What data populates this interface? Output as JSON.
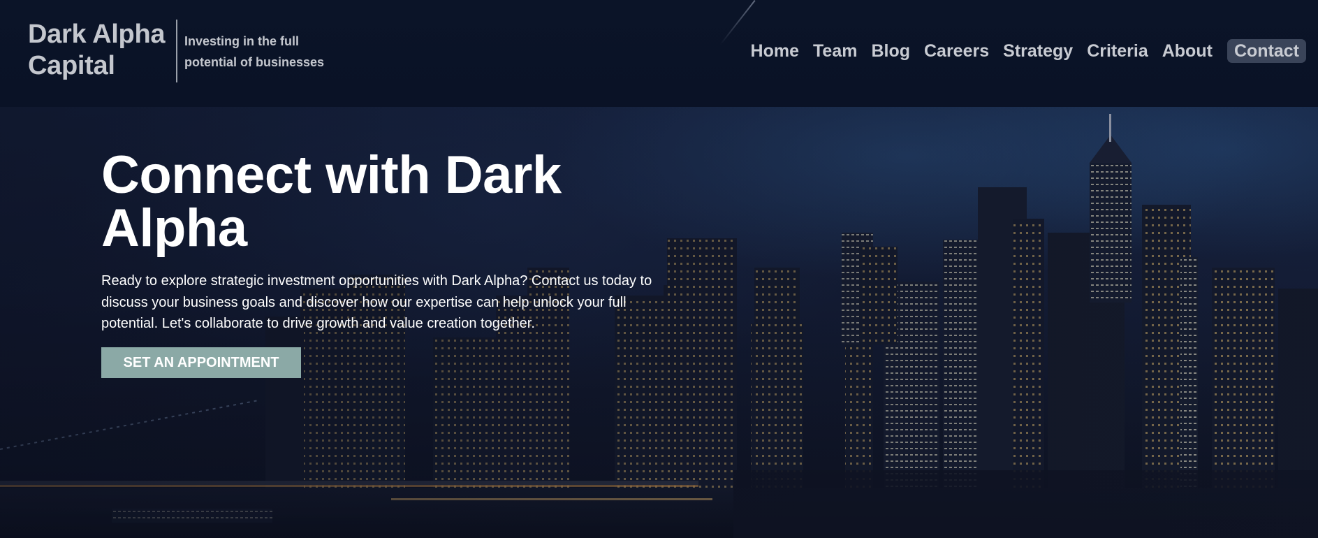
{
  "brand": {
    "name": "Dark Alpha Capital",
    "tagline": "Investing in the full potential of businesses"
  },
  "nav": {
    "items": [
      {
        "label": "Home"
      },
      {
        "label": "Team"
      },
      {
        "label": "Blog"
      },
      {
        "label": "Careers"
      },
      {
        "label": "Strategy"
      },
      {
        "label": "Criteria"
      },
      {
        "label": "About"
      },
      {
        "label": "Contact"
      }
    ]
  },
  "hero": {
    "title": "Connect with Dark Alpha",
    "text": "Ready to explore strategic investment opportunities with Dark Alpha? Contact us today to discuss your business goals and discover how our expertise can help unlock your full potential. Let's collaborate to drive growth and value creation together.",
    "cta_label": "SET AN APPOINTMENT"
  },
  "colors": {
    "header_bg": "#0b1428",
    "accent_button": "#8ba9a6",
    "contact_highlight": "#3a4459"
  }
}
